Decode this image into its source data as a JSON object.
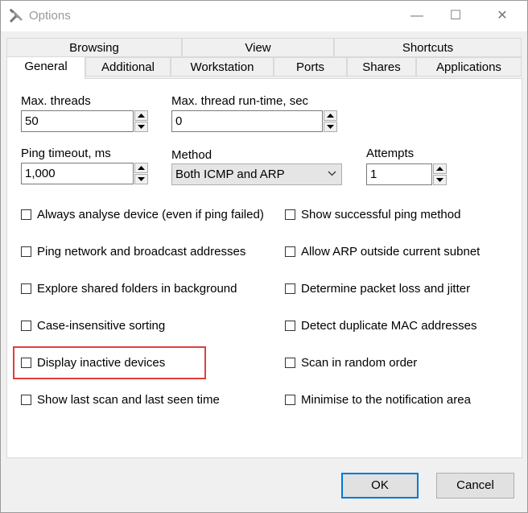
{
  "window": {
    "title": "Options",
    "minimize": "—",
    "maximize": "☐",
    "close": "✕"
  },
  "tabs_row1": [
    "Browsing",
    "View",
    "Shortcuts"
  ],
  "tabs_row2": [
    "General",
    "Additional",
    "Workstation",
    "Ports",
    "Shares",
    "Applications"
  ],
  "active_tab": "General",
  "fields": {
    "max_threads": {
      "label": "Max. threads",
      "value": "50"
    },
    "max_thread_runtime": {
      "label": "Max. thread run-time, sec",
      "value": "0"
    },
    "ping_timeout": {
      "label": "Ping timeout, ms",
      "value": "1,000"
    },
    "method": {
      "label": "Method",
      "value": "Both ICMP and ARP"
    },
    "attempts": {
      "label": "Attempts",
      "value": "1"
    }
  },
  "checkboxes_left": [
    {
      "label": "Always analyse device (even if ping failed)",
      "checked": false
    },
    {
      "label": "Ping network and broadcast addresses",
      "checked": false
    },
    {
      "label": "Explore shared folders in background",
      "checked": false
    },
    {
      "label": "Case-insensitive sorting",
      "checked": false
    },
    {
      "label": "Display inactive devices",
      "checked": false
    },
    {
      "label": "Show last scan and last seen time",
      "checked": false
    }
  ],
  "checkboxes_right": [
    {
      "label": "Show successful ping method",
      "checked": false
    },
    {
      "label": "Allow ARP outside current subnet",
      "checked": false
    },
    {
      "label": "Determine packet loss and jitter",
      "checked": false
    },
    {
      "label": "Detect duplicate MAC addresses",
      "checked": false
    },
    {
      "label": "Scan in random order",
      "checked": false
    },
    {
      "label": "Minimise to the notification area",
      "checked": false
    }
  ],
  "buttons": {
    "ok": "OK",
    "cancel": "Cancel"
  },
  "colors": {
    "highlight": "#e03e3e",
    "default_button_border": "#0078d7"
  }
}
